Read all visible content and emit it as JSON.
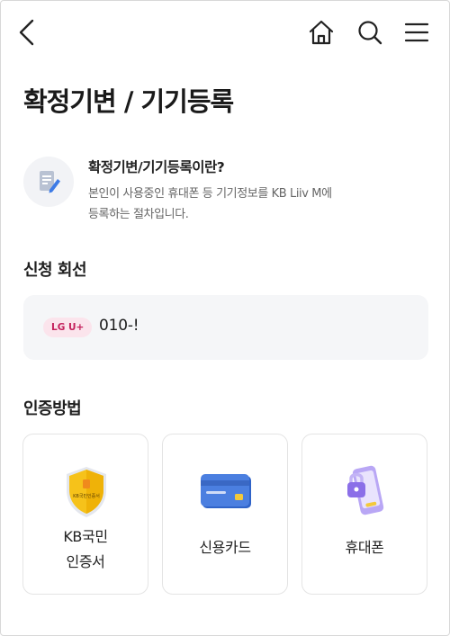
{
  "header": {
    "back_icon": "chevron-left-icon",
    "home_icon": "home-icon",
    "search_icon": "search-icon",
    "menu_icon": "hamburger-menu-icon"
  },
  "page": {
    "title": "확정기변 / 기기등록"
  },
  "info": {
    "icon": "document-pencil-icon",
    "title": "확정기변/기기등록이란?",
    "description_line1": "본인이 사용중인 휴대폰 등 기기정보를 KB Liiv M에",
    "description_line2": "등록하는 절차입니다."
  },
  "line_section": {
    "title": "신청 회선",
    "carrier_badge": "LG U+",
    "phone_number": "010-!"
  },
  "auth_section": {
    "title": "인증방법",
    "methods": [
      {
        "line1": "KB국민",
        "line2": "인증서",
        "icon": "kb-certificate-shield-icon",
        "shield_text": "KB국민인증서"
      },
      {
        "line1": "신용카드",
        "icon": "credit-card-icon"
      },
      {
        "line1": "휴대폰",
        "icon": "mobile-phone-lock-icon"
      }
    ]
  },
  "colors": {
    "carrier_badge_bg": "#fbe4ec",
    "carrier_badge_text": "#c4205c",
    "panel_bg": "#f5f6f8",
    "shield_yellow": "#f6c21a",
    "card_blue": "#4b7fe0",
    "phone_purple": "#8b6fe8"
  }
}
